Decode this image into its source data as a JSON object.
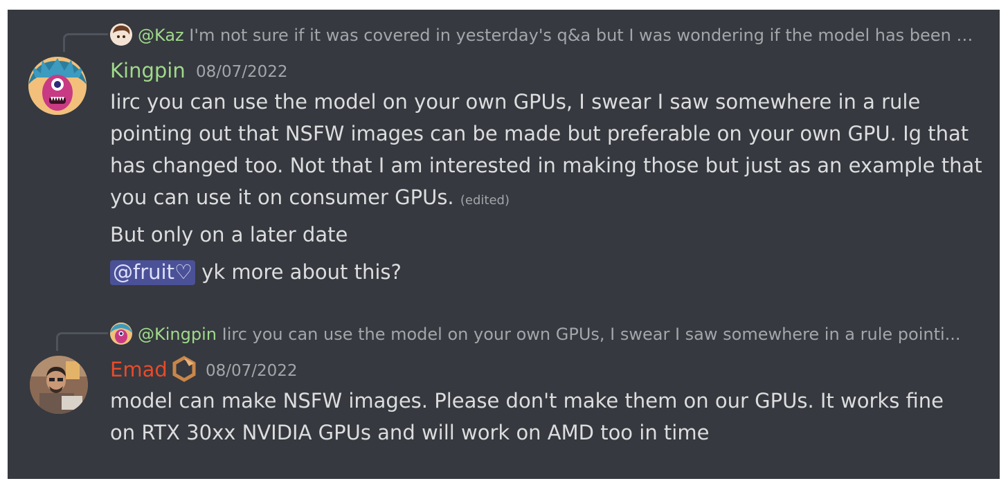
{
  "messages": [
    {
      "reply": {
        "author": "@Kaz",
        "preview": "I'm not sure if it was covered in yesterday's q&a but I was wondering if the model has been t..."
      },
      "author": "Kingpin",
      "timestamp": "08/07/2022",
      "lines": [
        "Iirc you can use the model on your own GPUs,  I swear  I saw somewhere in a rule pointing out that NSFW images can be made but preferable on your own GPU. Ig that has changed too. Not that I am interested in making those but just as an example that you can use it on consumer GPUs.",
        "But only on a later date",
        "yk more about this?"
      ],
      "edited_label": "(edited)",
      "mention": "@fruit♡"
    },
    {
      "reply": {
        "author": "@Kingpin",
        "preview": "Iirc you can use the model on your own GPUs,  I swear  I saw somewhere in a rule pointi..."
      },
      "author": "Emad",
      "timestamp": "08/07/2022",
      "lines": [
        "model can make NSFW images. Please don't make them on our GPUs. It works fine on RTX 30xx NVIDIA GPUs and will work on AMD too in time"
      ]
    }
  ],
  "colors": {
    "background": "#36393f",
    "kingpin_name": "#a0d98b",
    "emad_name": "#e84b2b",
    "kaz_name": "#a0d98b",
    "mention_bg": "#4b5196"
  },
  "icons": {
    "emad_badge": "hexagon-badge-icon"
  }
}
